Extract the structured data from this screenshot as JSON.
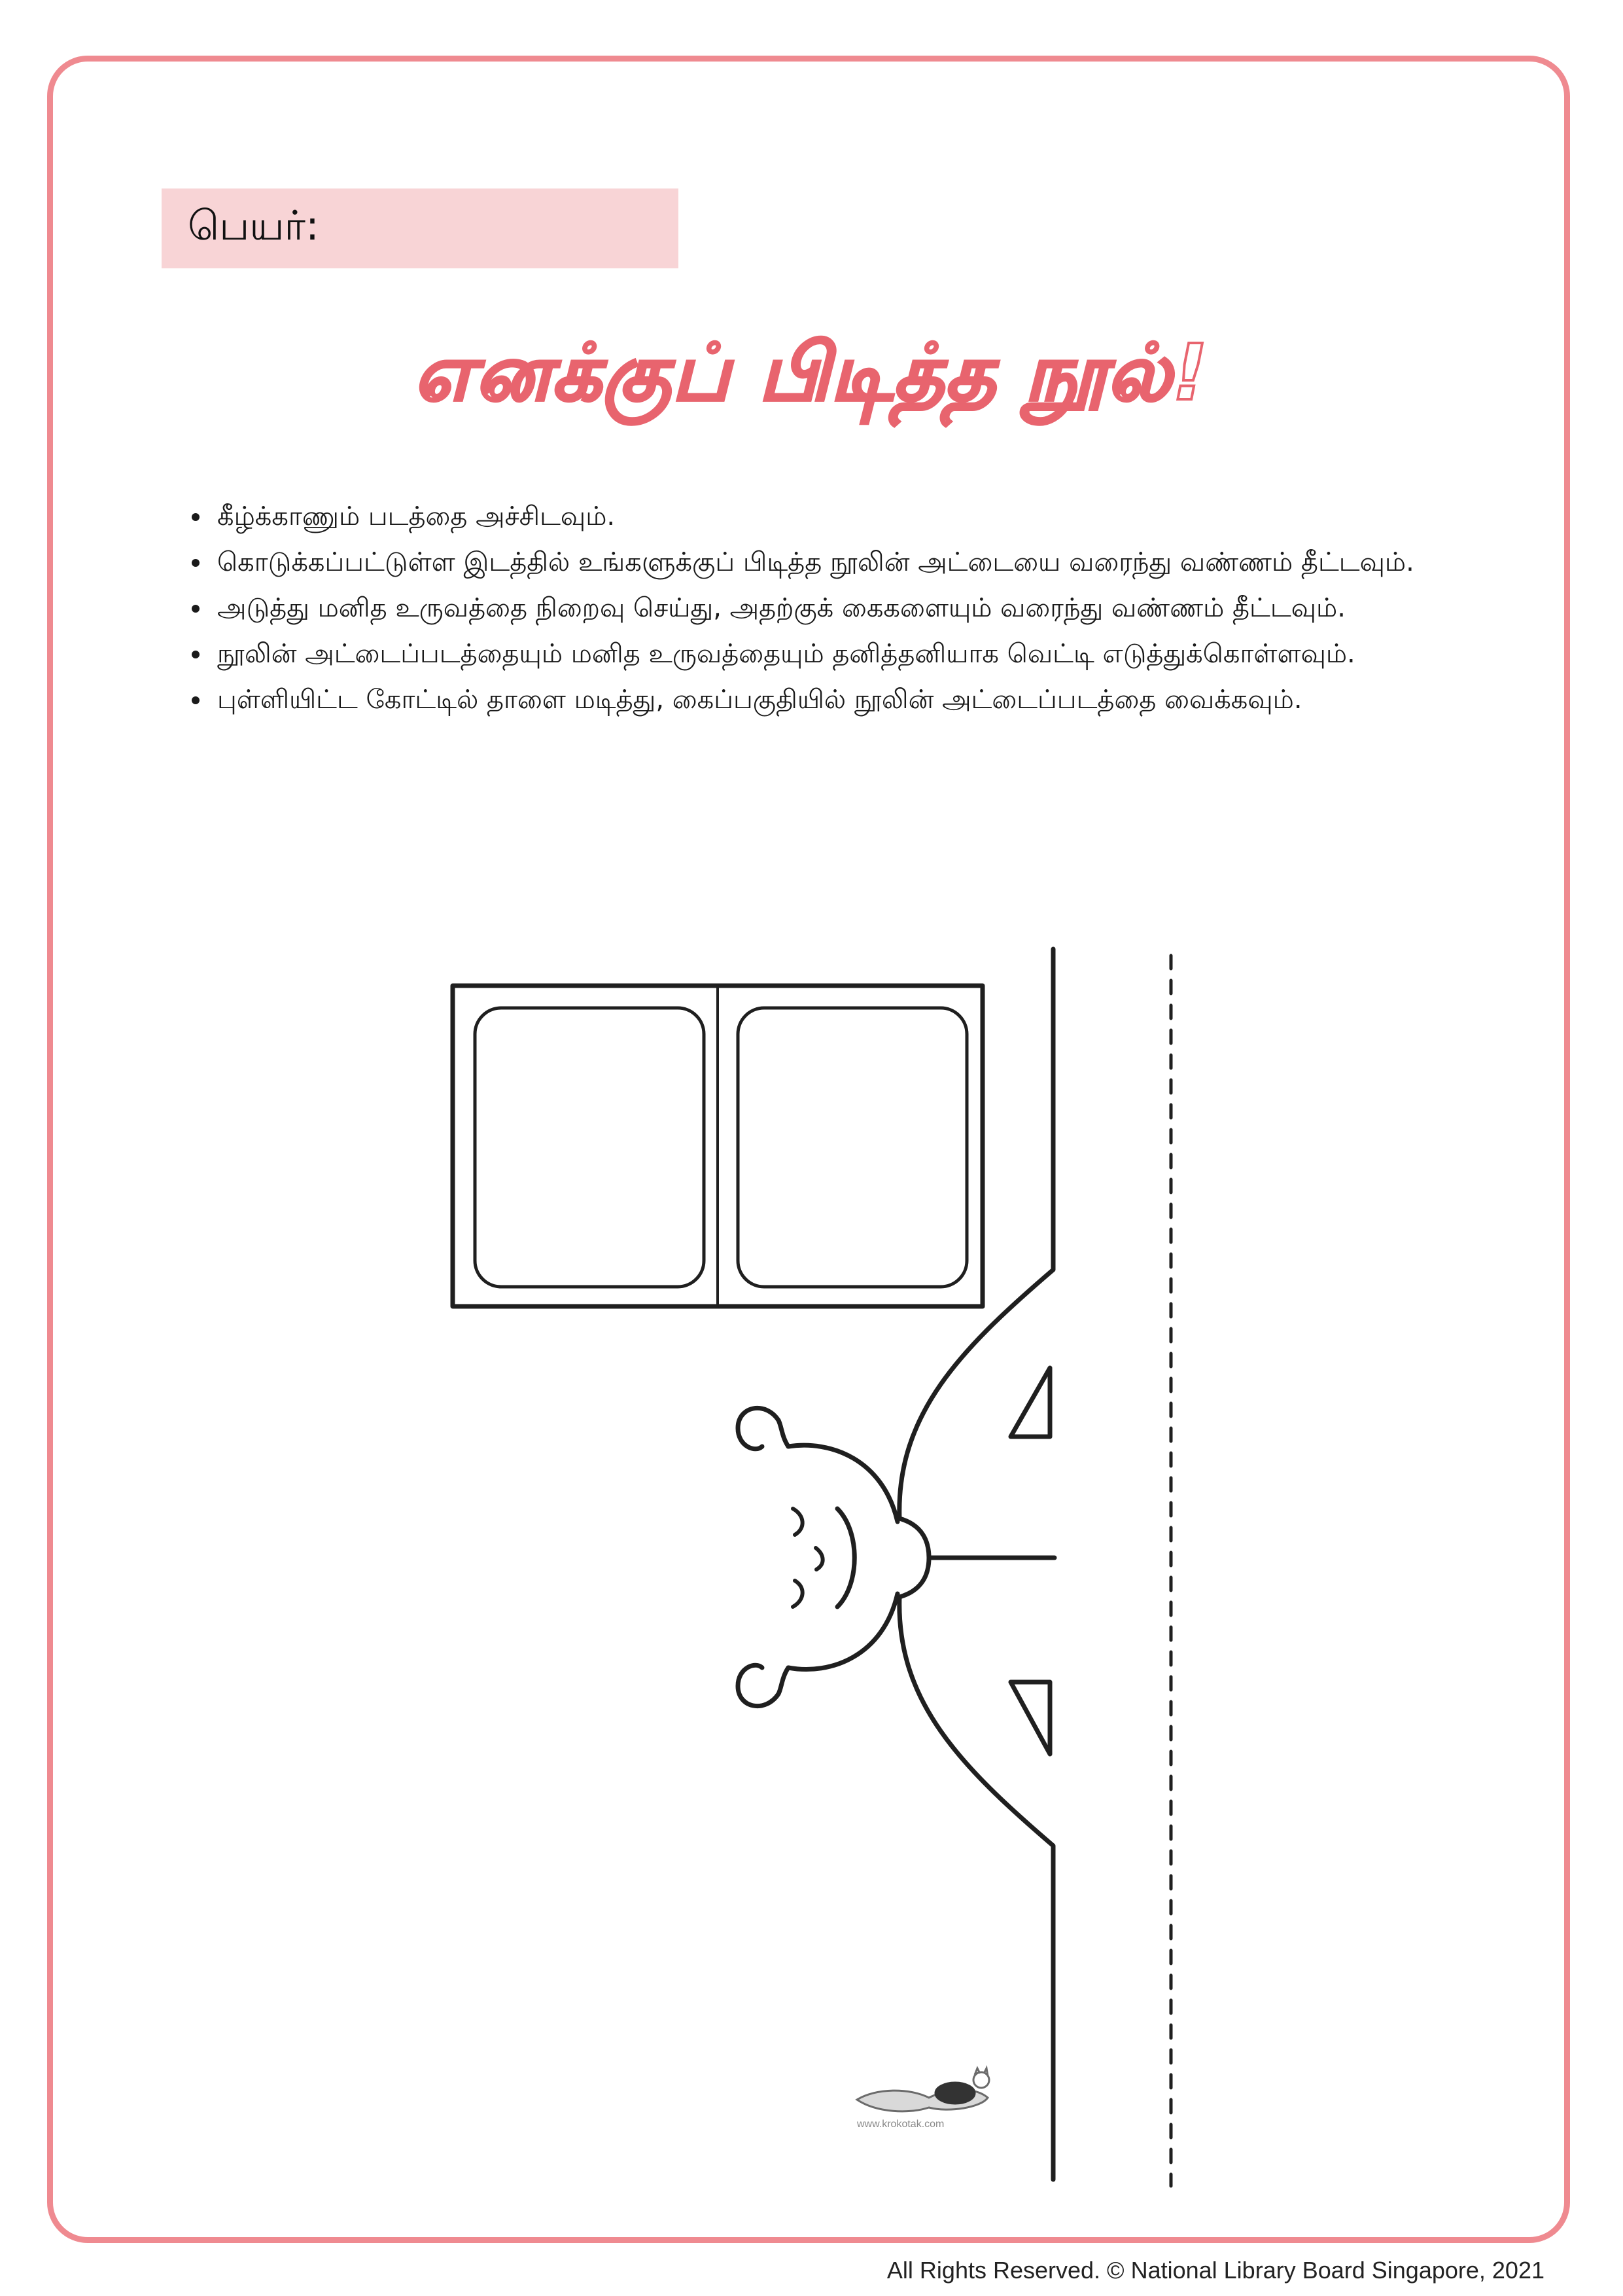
{
  "name_label": "பெயர்:",
  "title": "எனக்குப் பிடித்த நூல்!",
  "instructions": [
    "கீழ்க்காணும் படத்தை அச்சிடவும்.",
    "கொடுக்கப்பட்டுள்ள இடத்தில் உங்களுக்குப் பிடித்த நூலின் அட்டையை வரைந்து வண்ணம் தீட்டவும்.",
    "அடுத்து மனித உருவத்தை நிறைவு செய்து, அதற்குக் கைகளையும் வரைந்து வண்ணம் தீட்டவும்.",
    "நூலின் அட்டைப்படத்தையும் மனித உருவத்தையும் தனித்தனியாக வெட்டி எடுத்துக்கொள்ளவும்.",
    "புள்ளியிட்ட கோட்டில் தாளை மடித்து, கைப்பகுதியில் நூலின் அட்டைப்படத்தை வைக்கவும்."
  ],
  "logo_url_text": "www.krokotak.com",
  "footer": "All Rights Reserved. © National Library Board Singapore, 2021",
  "colors": {
    "accent": "#ef8a90",
    "name_box": "#f8d4d6",
    "title_stroke": "#e8646e"
  }
}
